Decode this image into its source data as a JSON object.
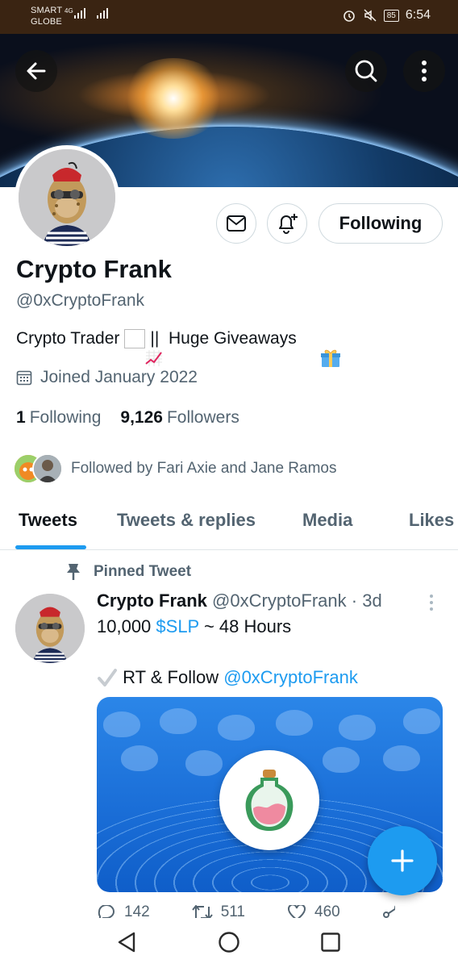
{
  "status_bar": {
    "carrier_line1": "SMART",
    "carrier_line2": "GLOBE",
    "network_type": "4G",
    "battery": "85",
    "time": "6:54"
  },
  "profile": {
    "name": "Crypto Frank",
    "handle": "@0xCryptoFrank",
    "bio_part1": "Crypto Trader",
    "bio_part2": "||  Huge Giveaways",
    "joined": "Joined January 2022",
    "following_count": "1",
    "following_label": "Following",
    "followers_count": "9,126",
    "followers_label": "Followers",
    "followed_by": "Followed by Fari Axie and Jane Ramos",
    "follow_button_label": "Following"
  },
  "tabs": [
    {
      "label": "Tweets",
      "active": true
    },
    {
      "label": "Tweets & replies",
      "active": false
    },
    {
      "label": "Media",
      "active": false
    },
    {
      "label": "Likes",
      "active": false
    }
  ],
  "tweet": {
    "pinned_label": "Pinned Tweet",
    "author_name": "Crypto Frank",
    "author_handle": "@0xCryptoFrank",
    "age": "· 3d",
    "line1_prefix": "10,000 ",
    "line1_link": "$SLP",
    "line1_suffix": " ~ 48 Hours",
    "line2_prefix": " RT & Follow ",
    "line2_link": "@0xCryptoFrank",
    "reply_count": "142",
    "retweet_count": "511",
    "like_count": "460"
  },
  "colors": {
    "accent": "#1d9bf0",
    "secondary_text": "#536471",
    "status_bar_bg": "#3a2412"
  },
  "icons": [
    "back-arrow-icon",
    "search-icon",
    "more-vertical-icon",
    "mail-icon",
    "bell-plus-icon",
    "calendar-icon",
    "pin-icon",
    "reply-icon",
    "retweet-icon",
    "like-icon",
    "share-icon",
    "compose-plus-icon",
    "nav-back-icon",
    "nav-home-icon",
    "nav-recents-icon"
  ]
}
